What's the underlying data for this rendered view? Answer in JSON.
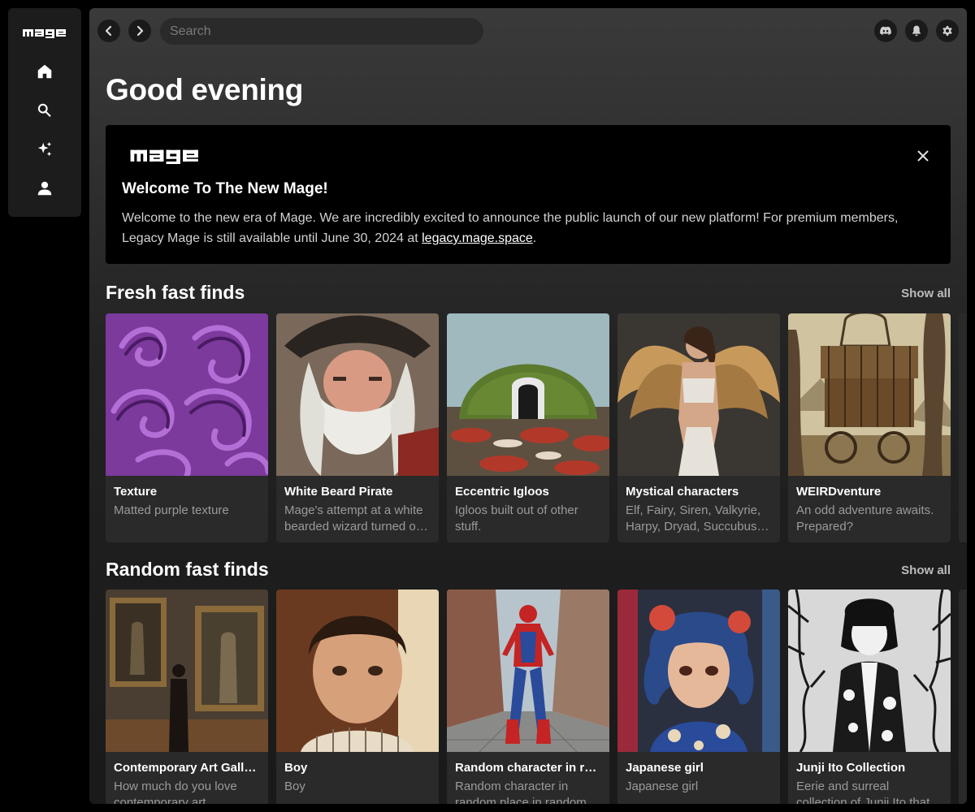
{
  "app": {
    "logo_text": "mage"
  },
  "sidebar": {
    "items": [
      {
        "name": "home",
        "icon": "home-icon"
      },
      {
        "name": "search",
        "icon": "search-icon"
      },
      {
        "name": "create",
        "icon": "sparkles-icon"
      },
      {
        "name": "profile",
        "icon": "user-icon"
      }
    ]
  },
  "topbar": {
    "search_placeholder": "Search",
    "icons": [
      "back-icon",
      "forward-icon",
      "discord-icon",
      "bell-icon",
      "gear-icon"
    ]
  },
  "greeting": "Good evening",
  "banner": {
    "logo_text": "mage",
    "title": "Welcome To The New Mage!",
    "text_before": "Welcome to the new era of Mage. We are incredibly excited to announce the public launch of our new platform! For premium members, Legacy Mage is still available until June 30, 2024 at ",
    "link_text": "legacy.mage.space",
    "text_after": "."
  },
  "sections": [
    {
      "title": "Fresh fast finds",
      "show_all": "Show all",
      "cards": [
        {
          "title": "Texture",
          "desc": "Matted purple texture"
        },
        {
          "title": "White Beard Pirate",
          "desc": "Mage's attempt at a white bearded wizard turned out to be a pirate"
        },
        {
          "title": "Eccentric Igloos",
          "desc": "Igloos built out of other stuff."
        },
        {
          "title": "Mystical characters",
          "desc": "Elf, Fairy, Siren, Valkyrie, Harpy, Dryad, Succubus, and more"
        },
        {
          "title": "WEIRDventure",
          "desc": "An odd adventure awaits. Prepared?"
        }
      ]
    },
    {
      "title": "Random fast finds",
      "show_all": "Show all",
      "cards": [
        {
          "title": "Contemporary Art Gallery",
          "desc": "How much do you love contemporary art"
        },
        {
          "title": "Boy",
          "desc": "Boy"
        },
        {
          "title": "Random character in random place",
          "desc": "Random character in random place in random pose"
        },
        {
          "title": "Japanese girl",
          "desc": "Japanese girl"
        },
        {
          "title": "Junji Ito Collection",
          "desc": "Eerie and surreal collection of Junji Ito that will haunt you"
        }
      ]
    }
  ]
}
